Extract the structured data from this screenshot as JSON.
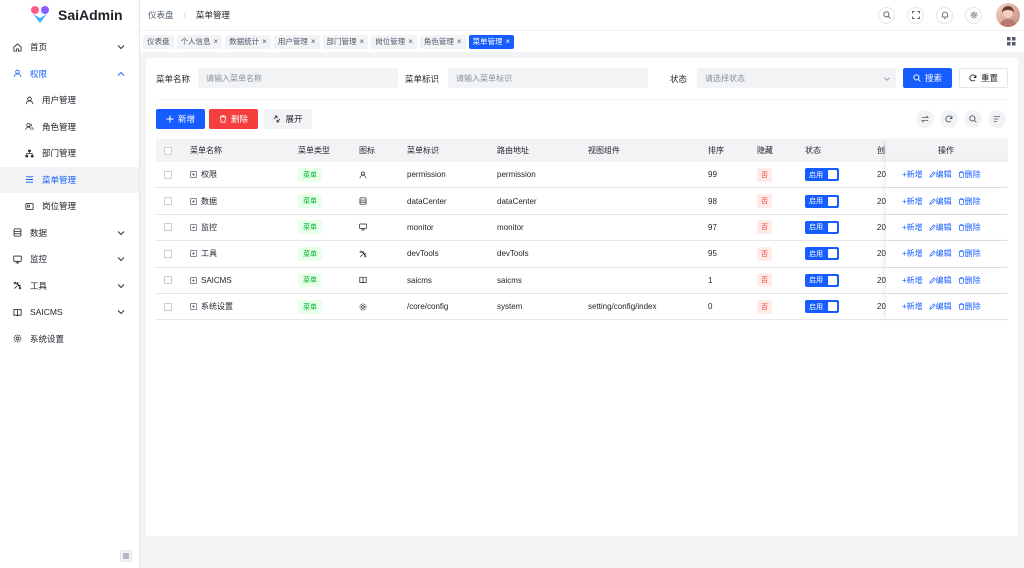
{
  "app": {
    "name": "SaiAdmin"
  },
  "breadcrumb": [
    "仪表盘",
    "菜单管理"
  ],
  "sidebar": {
    "items": [
      {
        "label": "首页",
        "icon": "home-icon",
        "chevron": "down"
      },
      {
        "label": "权限",
        "icon": "user-icon",
        "chevron": "up",
        "open": true
      },
      {
        "label": "用户管理",
        "icon": "user-icon",
        "sub": true
      },
      {
        "label": "角色管理",
        "icon": "user-group-icon",
        "sub": true
      },
      {
        "label": "部门管理",
        "icon": "org-icon",
        "sub": true
      },
      {
        "label": "菜单管理",
        "icon": "menu-icon",
        "sub": true,
        "active": true
      },
      {
        "label": "岗位管理",
        "icon": "post-icon",
        "sub": true
      },
      {
        "label": "数据",
        "icon": "data-icon",
        "chevron": "down"
      },
      {
        "label": "监控",
        "icon": "monitor-icon",
        "chevron": "down"
      },
      {
        "label": "工具",
        "icon": "tool-icon",
        "chevron": "down"
      },
      {
        "label": "SAICMS",
        "icon": "book-icon",
        "chevron": "down"
      },
      {
        "label": "系统设置",
        "icon": "gear-icon"
      }
    ]
  },
  "tabs": [
    {
      "label": "仪表盘",
      "closable": false
    },
    {
      "label": "个人信息",
      "closable": true
    },
    {
      "label": "数据统计",
      "closable": true
    },
    {
      "label": "用户管理",
      "closable": true
    },
    {
      "label": "部门管理",
      "closable": true
    },
    {
      "label": "岗位管理",
      "closable": true
    },
    {
      "label": "角色管理",
      "closable": true
    },
    {
      "label": "菜单管理",
      "closable": true,
      "active": true
    }
  ],
  "tab_close_glyph": "×",
  "search": {
    "name_label": "菜单名称",
    "name_placeholder": "请输入菜单名称",
    "code_label": "菜单标识",
    "code_placeholder": "请输入菜单标识",
    "status_label": "状态",
    "status_placeholder": "请选择状态",
    "search_button": "搜索",
    "reset_button": "重置"
  },
  "toolbar": {
    "add": "新增",
    "delete": "删除",
    "expand": "展开"
  },
  "table": {
    "headers": {
      "name": "菜单名称",
      "type": "菜单类型",
      "icon": "图标",
      "code": "菜单标识",
      "route": "路由地址",
      "component": "视图组件",
      "sort": "排序",
      "hidden": "隐藏",
      "status": "状态",
      "created": "创",
      "ops": "操作"
    },
    "rows": [
      {
        "name": "权限",
        "type": "菜单",
        "icon": "user-icon",
        "code": "permission",
        "route": "permission",
        "component": "",
        "sort": "99",
        "hidden": "否",
        "status": "启用",
        "created": "20"
      },
      {
        "name": "数据",
        "type": "菜单",
        "icon": "data-icon",
        "code": "dataCenter",
        "route": "dataCenter",
        "component": "",
        "sort": "98",
        "hidden": "否",
        "status": "启用",
        "created": "20"
      },
      {
        "name": "监控",
        "type": "菜单",
        "icon": "monitor-icon",
        "code": "monitor",
        "route": "monitor",
        "component": "",
        "sort": "97",
        "hidden": "否",
        "status": "启用",
        "created": "20"
      },
      {
        "name": "工具",
        "type": "菜单",
        "icon": "tool-icon",
        "code": "devTools",
        "route": "devTools",
        "component": "",
        "sort": "95",
        "hidden": "否",
        "status": "启用",
        "created": "20"
      },
      {
        "name": "SAICMS",
        "type": "菜单",
        "icon": "book-icon",
        "code": "saicms",
        "route": "saicms",
        "component": "",
        "sort": "1",
        "hidden": "否",
        "status": "启用",
        "created": "20"
      },
      {
        "name": "系统设置",
        "type": "菜单",
        "icon": "gear-icon",
        "code": "/core/config",
        "route": "system",
        "component": "setting/config/index",
        "sort": "0",
        "hidden": "否",
        "status": "启用",
        "created": "20"
      }
    ],
    "ops": {
      "add": "+新增",
      "edit": "编辑",
      "delete": "删除"
    }
  },
  "colors": {
    "primary": "#165dff",
    "danger": "#f53f3f",
    "success": "#00b42a"
  }
}
